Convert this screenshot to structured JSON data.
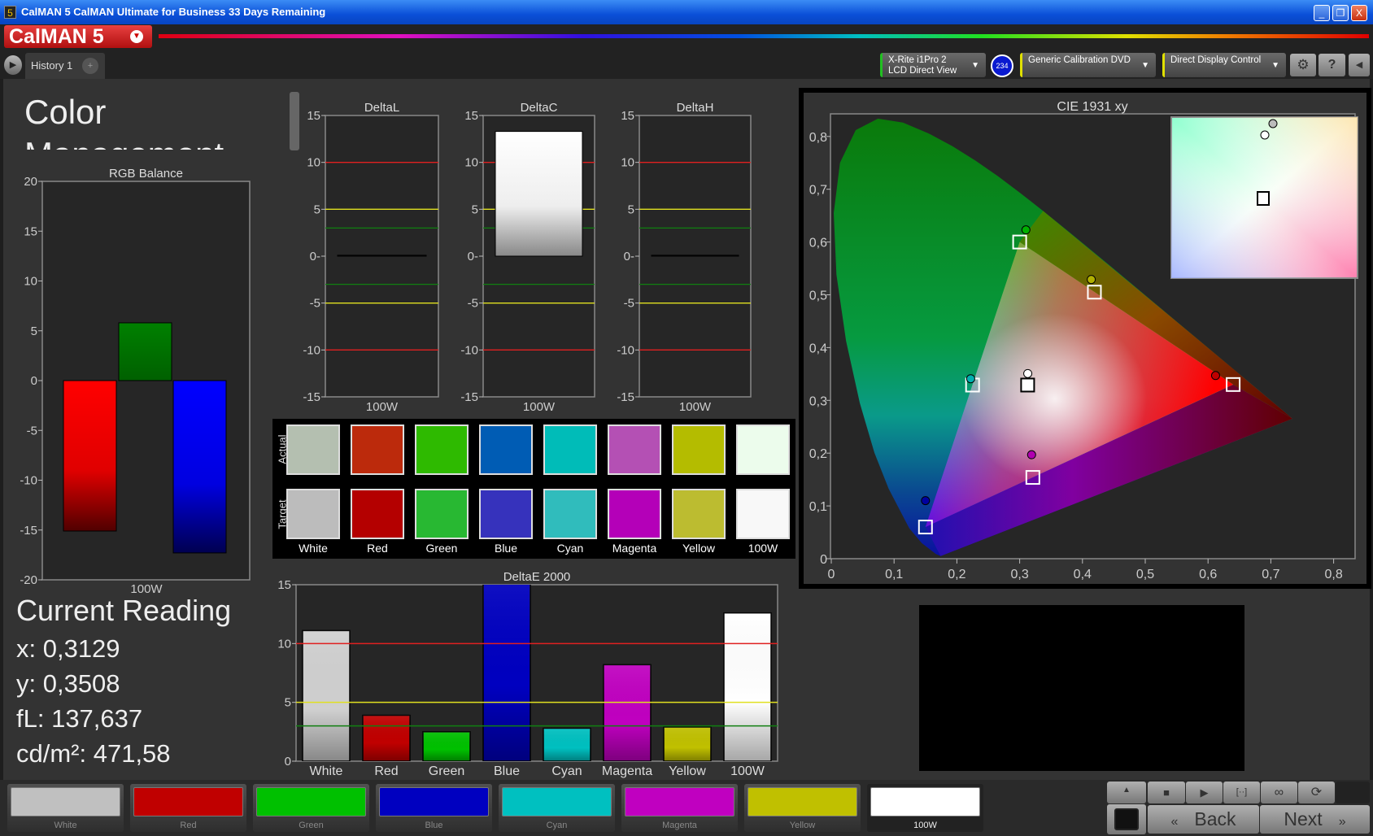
{
  "window": {
    "title": "CalMAN 5 CalMAN Ultimate for Business 33 Days Remaining",
    "app_icon": "5",
    "minimize": "_",
    "restore": "❐",
    "close": "X"
  },
  "logo": {
    "text": "CalMAN 5"
  },
  "tabs": {
    "items": [
      {
        "label": "History 1"
      }
    ],
    "add": "+",
    "nav_left": "▶"
  },
  "toolbar": {
    "meter_line1": "X-Rite i1Pro 2",
    "meter_line2": "LCD Direct View",
    "meter_badge": "234",
    "source": "Generic Calibration DVD",
    "display": "Direct Display Control",
    "settings_icon": "⚙",
    "help_icon": "?",
    "collapse_icon": "◀",
    "accent_colors": {
      "meter": "#22c022",
      "source": "#e0e000",
      "display": "#e0e000"
    }
  },
  "page": {
    "title": "Color Management"
  },
  "current_reading": {
    "heading": "Current Reading",
    "x": "x: 0,3129",
    "y": "y: 0,3508",
    "fl": "fL: 137,637",
    "cdm2": "cd/m²: 471,58"
  },
  "swatches": {
    "row_actual": "Actual",
    "row_target": "Target",
    "items": [
      {
        "label": "White",
        "actual": "#b4bfb0",
        "target": "#bcbcbc"
      },
      {
        "label": "Red",
        "actual": "#bc2a0c",
        "target": "#b40000"
      },
      {
        "label": "Green",
        "actual": "#2eba00",
        "target": "#28b832"
      },
      {
        "label": "Blue",
        "actual": "#005cb4",
        "target": "#3632bc"
      },
      {
        "label": "Cyan",
        "actual": "#00bcb8",
        "target": "#30bcbc"
      },
      {
        "label": "Magenta",
        "actual": "#b450b4",
        "target": "#b400b8"
      },
      {
        "label": "Yellow",
        "actual": "#b4bc00",
        "target": "#bcbc30"
      },
      {
        "label": "100W",
        "actual": "#ecfcec",
        "target": "#f8f8f8"
      }
    ]
  },
  "chart_data": [
    {
      "id": "rgb",
      "type": "bar",
      "title": "RGB Balance",
      "categories": [
        "100W"
      ],
      "series": [
        {
          "color": "#ff0000",
          "values": [
            -15.1
          ]
        },
        {
          "color": "#008000",
          "values": [
            5.8
          ]
        },
        {
          "color": "#0000ff",
          "values": [
            -17.3
          ]
        }
      ],
      "ylim": [
        -20,
        20
      ],
      "yticks": [
        "20",
        "15",
        "10",
        "5",
        "0",
        "-5",
        "-10",
        "-15",
        "-20"
      ],
      "xlabel": "100W"
    },
    {
      "id": "deltaL",
      "type": "bar",
      "title": "DeltaL",
      "categories": [
        "100W"
      ],
      "values": [
        0.1
      ],
      "ylim": [
        -15,
        15
      ],
      "yticks": [
        "15",
        "10",
        "5",
        "0-",
        "-5",
        "-10",
        "-15"
      ],
      "reference_lines": [
        {
          "value": 10,
          "color": "#e02020"
        },
        {
          "value": 5,
          "color": "#e0e020"
        },
        {
          "value": 3,
          "color": "#108010"
        },
        {
          "value": -3,
          "color": "#108010"
        },
        {
          "value": -5,
          "color": "#e0e020"
        },
        {
          "value": -10,
          "color": "#e02020"
        }
      ]
    },
    {
      "id": "deltaC",
      "type": "bar",
      "title": "DeltaC",
      "categories": [
        "100W"
      ],
      "values": [
        13.3
      ],
      "ylim": [
        -15,
        15
      ],
      "yticks": [
        "15",
        "10",
        "5",
        "0-",
        "-5",
        "-10",
        "-15"
      ]
    },
    {
      "id": "deltaH",
      "type": "bar",
      "title": "DeltaH",
      "categories": [
        "100W"
      ],
      "values": [
        0.1
      ],
      "ylim": [
        -15,
        15
      ],
      "yticks": [
        "15",
        "10",
        "5",
        "0-",
        "-5",
        "-10",
        "-15"
      ]
    },
    {
      "id": "deltaE",
      "type": "bar",
      "title": "DeltaE 2000",
      "categories": [
        "White",
        "Red",
        "Green",
        "Blue",
        "Cyan",
        "Magenta",
        "Yellow",
        "100W"
      ],
      "values": [
        11.1,
        3.9,
        2.5,
        16.0,
        2.8,
        8.2,
        2.9,
        12.6
      ],
      "colors": [
        "#d0d0d0",
        "#c00000",
        "#00c000",
        "#0000c0",
        "#00c0c0",
        "#c000c0",
        "#c0c000",
        "#ffffff"
      ],
      "ylim": [
        0,
        15
      ],
      "yticks": [
        "15",
        "10",
        "5",
        "0"
      ],
      "reference_lines": [
        {
          "value": 10,
          "color": "#e02020"
        },
        {
          "value": 5,
          "color": "#e0e020"
        },
        {
          "value": 3,
          "color": "#108010"
        }
      ]
    },
    {
      "id": "cie",
      "type": "scatter",
      "title": "CIE 1931 xy",
      "xlim": [
        0,
        0.84
      ],
      "ylim": [
        0,
        0.84
      ],
      "xticks": [
        "0",
        "0,1",
        "0,2",
        "0,3",
        "0,4",
        "0,5",
        "0,6",
        "0,7",
        "0,8"
      ],
      "yticks": [
        "0",
        "0,1",
        "0,2",
        "0,3",
        "0,4",
        "0,5",
        "0,6",
        "0,7",
        "0,8"
      ],
      "targets": [
        {
          "name": "Red",
          "x": 0.64,
          "y": 0.33
        },
        {
          "name": "Green",
          "x": 0.3,
          "y": 0.6
        },
        {
          "name": "Blue",
          "x": 0.15,
          "y": 0.06
        },
        {
          "name": "White",
          "x": 0.3127,
          "y": 0.329
        },
        {
          "name": "Cyan",
          "x": 0.225,
          "y": 0.329
        },
        {
          "name": "Magenta",
          "x": 0.321,
          "y": 0.154
        },
        {
          "name": "Yellow",
          "x": 0.419,
          "y": 0.505
        }
      ],
      "actuals": [
        {
          "name": "Red",
          "x": 0.612,
          "y": 0.347,
          "color": "#c00000"
        },
        {
          "name": "Green",
          "x": 0.31,
          "y": 0.623,
          "color": "#00b000"
        },
        {
          "name": "Blue",
          "x": 0.15,
          "y": 0.11,
          "color": "#0000a0"
        },
        {
          "name": "White",
          "x": 0.3129,
          "y": 0.3508,
          "color": "#ffffff"
        },
        {
          "name": "Cyan",
          "x": 0.222,
          "y": 0.341,
          "color": "#00b0b0"
        },
        {
          "name": "Magenta",
          "x": 0.319,
          "y": 0.197,
          "color": "#b000b0"
        },
        {
          "name": "Yellow",
          "x": 0.414,
          "y": 0.529,
          "color": "#b0b000"
        }
      ]
    }
  ],
  "bottom": {
    "buttons": [
      {
        "label": "White",
        "color": "#c0c0c0"
      },
      {
        "label": "Red",
        "color": "#c00000"
      },
      {
        "label": "Green",
        "color": "#00c000"
      },
      {
        "label": "Blue",
        "color": "#0000c0"
      },
      {
        "label": "Cyan",
        "color": "#00c0c0"
      },
      {
        "label": "Magenta",
        "color": "#c000c0"
      },
      {
        "label": "Yellow",
        "color": "#c0c000"
      },
      {
        "label": "100W",
        "color": "#ffffff"
      }
    ],
    "back": "Back",
    "next": "Next",
    "back_icon": "«",
    "next_icon": "»",
    "stop_icon": "■",
    "play_icon": "▶",
    "bracket_icon": "[··]",
    "loop_icon": "∞",
    "refresh_icon": "⟳",
    "up_icon": "▲"
  }
}
